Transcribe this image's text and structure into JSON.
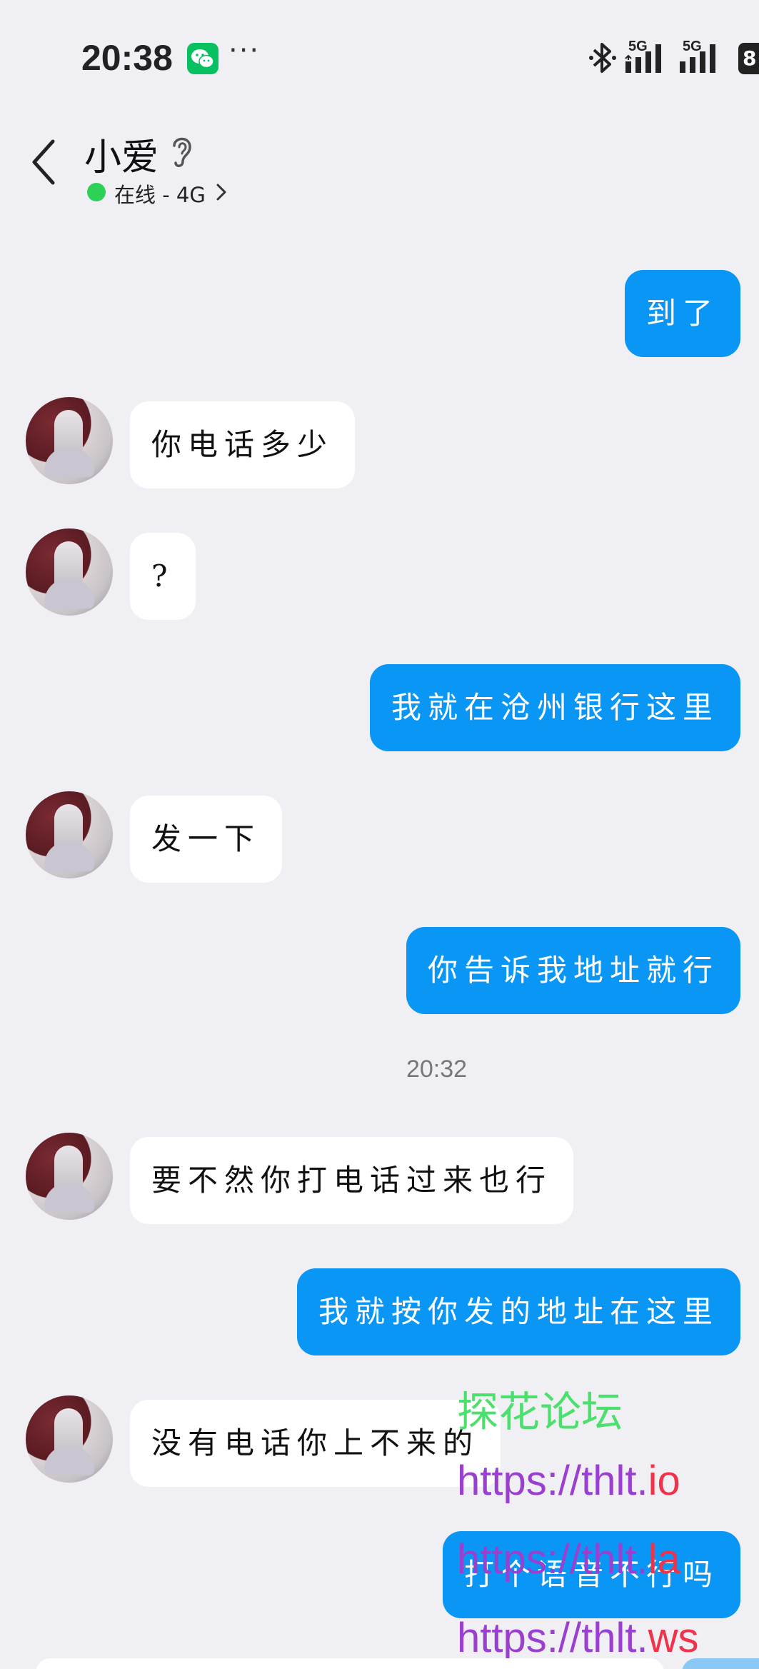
{
  "status_bar": {
    "time": "20:38",
    "more": "···",
    "network_1": "5G",
    "network_2": "5G",
    "battery": "8"
  },
  "header": {
    "contact_name": "小爱",
    "online_status": "在线 - 4G"
  },
  "messages": [
    {
      "direction": "out",
      "text": "到了"
    },
    {
      "direction": "in",
      "text": "你电话多少"
    },
    {
      "direction": "in",
      "text": "?"
    },
    {
      "direction": "out",
      "text": "我就在沧州银行这里"
    },
    {
      "direction": "in",
      "text": "发一下"
    },
    {
      "direction": "out",
      "text": "你告诉我地址就行"
    },
    {
      "direction": "in",
      "text": "要不然你打电话过来也行"
    },
    {
      "direction": "out",
      "text": "我就按你发的地址在这里"
    },
    {
      "direction": "in",
      "text": "没有电话你上不来的"
    },
    {
      "direction": "out",
      "text": "打个语音不行吗"
    }
  ],
  "timestamp": "20:32",
  "watermark": {
    "brand": "探花论坛",
    "links": [
      {
        "base": "https://thlt.",
        "tld": "io"
      },
      {
        "base": "https://thlt.",
        "tld": "la"
      },
      {
        "base": "https://thlt.",
        "tld": "ws"
      }
    ]
  },
  "colors": {
    "background": "#efeff4",
    "outgoing_bubble": "#0a96f4",
    "incoming_bubble": "#ffffff",
    "online_dot": "#2ed158",
    "watermark_brand": "#4be06b",
    "watermark_link": "#9a3fd0",
    "watermark_tld": "#f0324a"
  }
}
